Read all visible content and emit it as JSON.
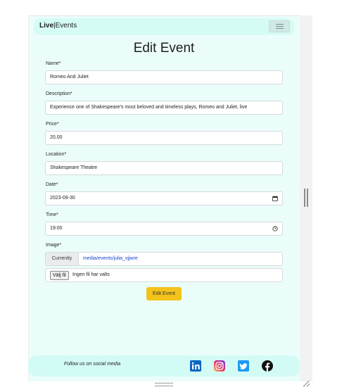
{
  "navbar": {
    "brand_bold": "Live",
    "brand_separator": "|",
    "brand_rest": "Events"
  },
  "page_title": "Edit Event",
  "form": {
    "name": {
      "label": "Name*",
      "value": "Romeo And Juliet"
    },
    "description": {
      "label": "Description*",
      "value": "Experience one of Shakespeare's most beloved and timeless plays, Romeo and Juliet, live"
    },
    "price": {
      "label": "Price*",
      "value": "20,00"
    },
    "location": {
      "label": "Location*",
      "value": "Shakespeare Theatre"
    },
    "date": {
      "label": "Date*",
      "value": "2023-09-30"
    },
    "time": {
      "label": "Time*",
      "value": "19:00"
    },
    "image": {
      "label": "Image*",
      "currently_label": "Currently",
      "current_file": "media/events/julia_vjjwre",
      "file_button": "Välj fil",
      "file_status": "Ingen fil har valts"
    },
    "submit_label": "Edit Event"
  },
  "footer": {
    "text": "Follow us on social media",
    "icons": [
      "linkedin-icon",
      "instagram-icon",
      "twitter-icon",
      "facebook-icon"
    ]
  },
  "colors": {
    "page_bg": "#ebfdfb",
    "navbar_bg": "#d5fbf5",
    "button": "#f3c21b",
    "link": "#1a44d6"
  }
}
